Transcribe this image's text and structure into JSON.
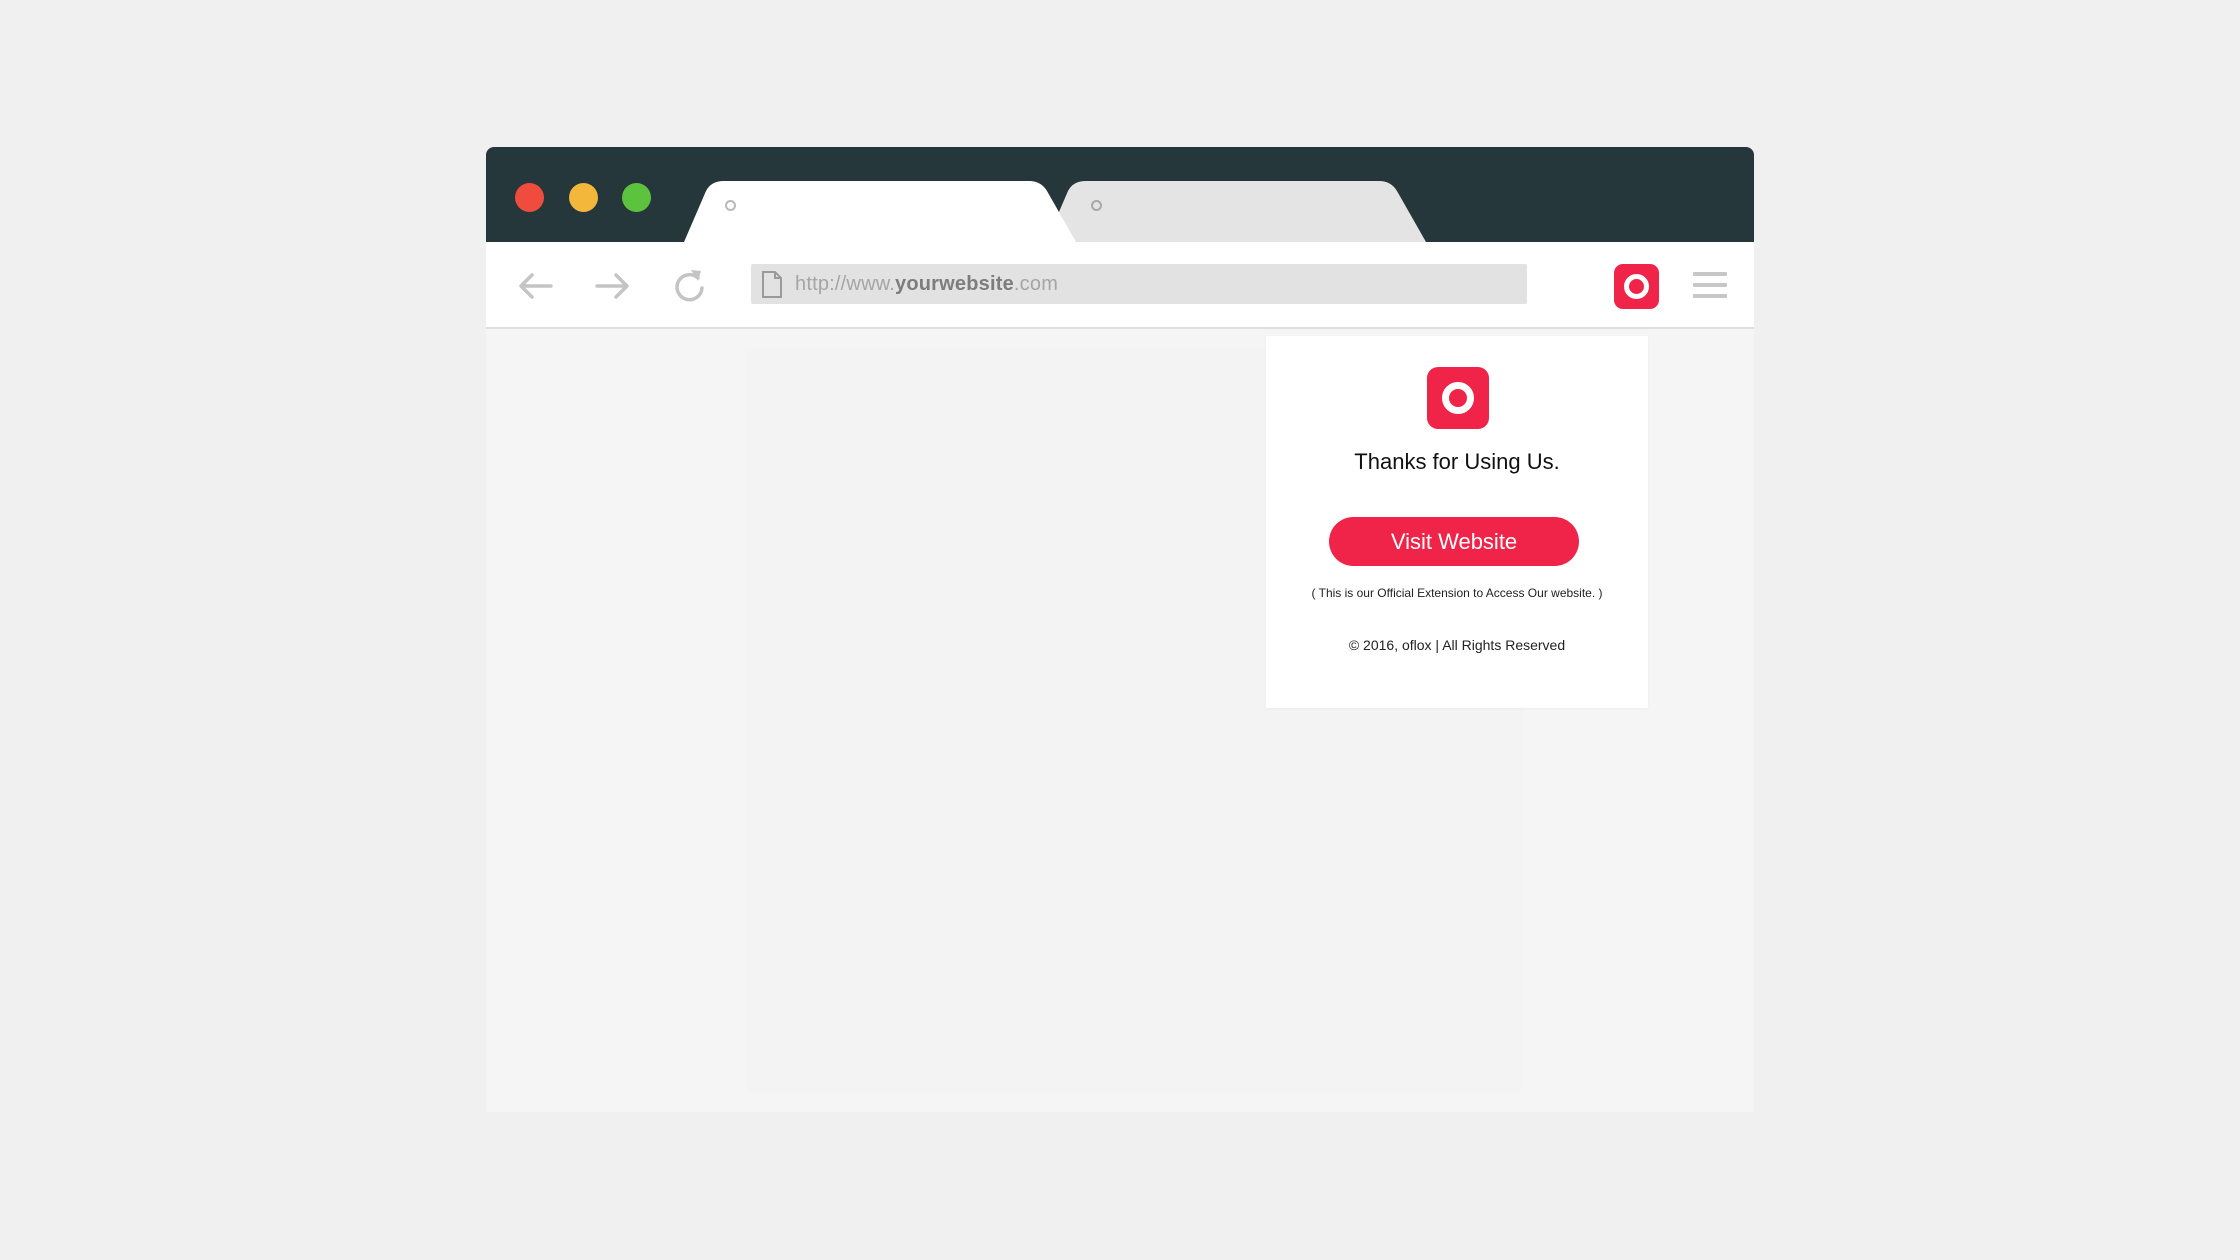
{
  "browser": {
    "window_controls": [
      "close",
      "minimize",
      "maximize"
    ],
    "colors": {
      "titlebar": "#25373a",
      "close": "#f04c3e",
      "minimize": "#f3b73c",
      "maximize": "#5cc33f",
      "accent": "#f02349"
    },
    "tabs": [
      {
        "label": "",
        "active": true
      },
      {
        "label": "",
        "active": false
      }
    ],
    "toolbar": {
      "back_icon": "arrow-left-icon",
      "forward_icon": "arrow-right-icon",
      "reload_icon": "reload-icon",
      "menu_icon": "hamburger-menu-icon",
      "extension_icon": "extension-logo-icon"
    },
    "address_bar": {
      "prefix": "http://www.",
      "domain": "yourwebsite",
      "suffix": ".com"
    }
  },
  "popup": {
    "logo_icon": "brand-logo-icon",
    "title": "Thanks for Using Us.",
    "button_label": "Visit Website",
    "note": "( This is our Official Extension to Access Our website. )",
    "footer": "© 2016, oflox | All Rights Reserved"
  }
}
